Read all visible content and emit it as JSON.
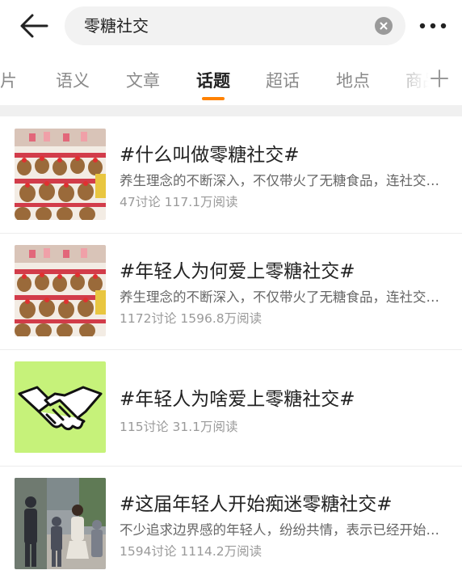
{
  "search": {
    "query": "零糖社交"
  },
  "icons": {
    "back": "arrow-left-icon",
    "clear": "clear-circle-icon",
    "more": "more-dots-icon",
    "add": "plus-icon"
  },
  "tabs": [
    {
      "label": "图片",
      "active": false
    },
    {
      "label": "语义",
      "active": false
    },
    {
      "label": "文章",
      "active": false
    },
    {
      "label": "话题",
      "active": true
    },
    {
      "label": "超话",
      "active": false
    },
    {
      "label": "地点",
      "active": false
    },
    {
      "label": "商品",
      "active": false
    }
  ],
  "colors": {
    "accent": "#ff8200",
    "title": "#222222",
    "meta": "#9a9a9a",
    "thumb_green": "#c6f27a"
  },
  "topics": [
    {
      "title": "#什么叫做零糖社交#",
      "desc": "养生理念的不断深入，不仅带火了无糖食品，连社交也开始讲究零糖了",
      "stats": "47讨论 117.1万阅读",
      "thumb": "plush-toys-display"
    },
    {
      "title": "#年轻人为何爱上零糖社交#",
      "desc": "养生理念的不断深入，不仅带火了无糖食品，连社交也开始讲究零糖了",
      "stats": "1172讨论 1596.8万阅读",
      "thumb": "plush-toys-display"
    },
    {
      "title": "#年轻人为啥爱上零糖社交#",
      "desc": "",
      "stats": "115讨论 31.1万阅读",
      "thumb": "handshake-illustration"
    },
    {
      "title": "#这届年轻人开始痴迷零糖社交#",
      "desc": "不少追求边界感的年轻人，纷纷共情，表示已经开始零糖社交",
      "stats": "1594讨论 1114.2万阅读",
      "thumb": "people-outdoor-photo"
    }
  ]
}
